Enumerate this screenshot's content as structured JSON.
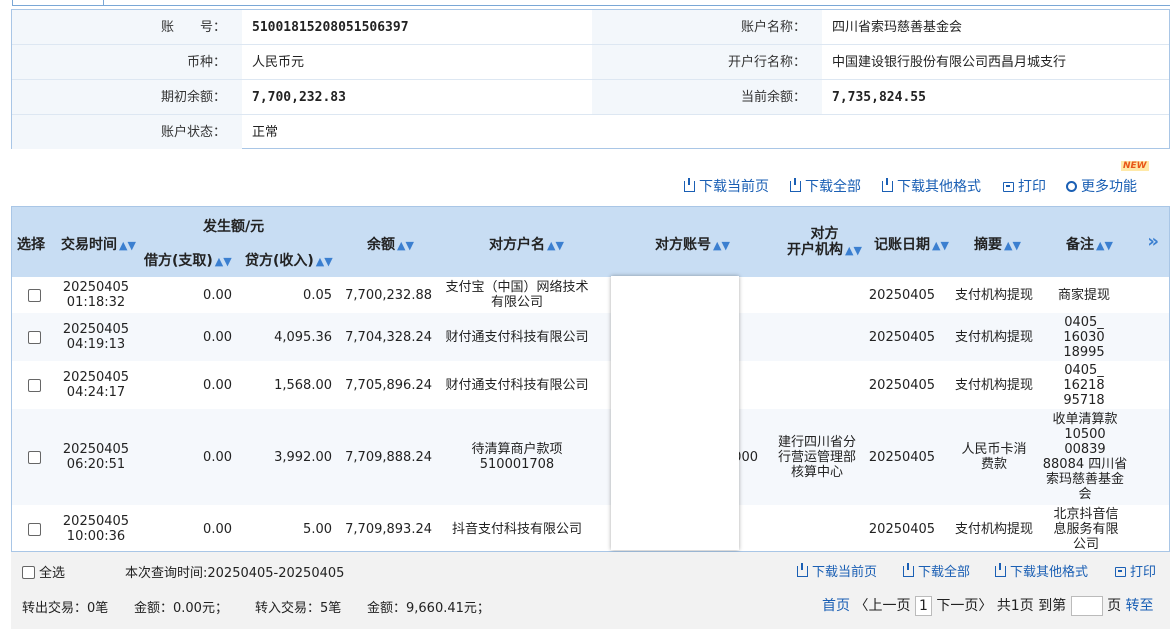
{
  "account": {
    "no_label": "账　　号：",
    "no_value": "51001815208051506397",
    "name_label": "账户名称：",
    "name_value": "四川省索玛慈善基金会",
    "currency_label": "币种：",
    "currency_value": "人民币元",
    "bank_label": "开户行名称：",
    "bank_value": "中国建设银行股份有限公司西昌月城支行",
    "opening_label": "期初余额：",
    "opening_value": "7,700,232.83",
    "current_label": "当前余额：",
    "current_value": "7,735,824.55",
    "status_label": "账户状态：",
    "status_value": "正常"
  },
  "toolbar": {
    "download_page": "下载当前页",
    "download_all": "下载全部",
    "download_other": "下载其他格式",
    "print": "打印",
    "more": "更多功能",
    "new_badge": "NEW"
  },
  "table": {
    "headers": {
      "select": "选择",
      "time": "交易时间",
      "amount_group": "发生额/元",
      "debit": "借方(支取)",
      "credit": "贷方(收入)",
      "balance": "余额",
      "counter_name": "对方户名",
      "counter_account": "对方账号",
      "counter_bank_1": "对方",
      "counter_bank_2": "开户机构",
      "post_date": "记账日期",
      "summary": "摘要",
      "remark": "备注",
      "expand": "»"
    },
    "rows": [
      {
        "date": "20250405",
        "time": "01:18:32",
        "debit": "0.00",
        "credit": "0.05",
        "balance": "7,700,232.88",
        "counter_name": "支付宝（中国）网络技术有限公司",
        "counter_account": "",
        "counter_bank": "",
        "post_date": "20250405",
        "summary": "支付机构提现",
        "remark": "商家提现"
      },
      {
        "date": "20250405",
        "time": "04:19:13",
        "debit": "0.00",
        "credit": "4,095.36",
        "balance": "7,704,328.24",
        "counter_name": "财付通支付科技有限公司",
        "counter_account": "",
        "counter_bank": "",
        "post_date": "20250405",
        "summary": "支付机构提现",
        "remark": "0405_ 16030 18995"
      },
      {
        "date": "20250405",
        "time": "04:24:17",
        "debit": "0.00",
        "credit": "1,568.00",
        "balance": "7,705,896.24",
        "counter_name": "财付通支付科技有限公司",
        "counter_account": "",
        "counter_bank": "",
        "post_date": "20250405",
        "summary": "支付机构提现",
        "remark": "0405_ 16218 95718"
      },
      {
        "date": "20250405",
        "time": "06:20:51",
        "debit": "0.00",
        "credit": "3,992.00",
        "balance": "7,709,888.24",
        "counter_name": "待清算商户款项510001708",
        "counter_account": "000",
        "counter_bank": "建行四川省分行营运管理部核算中心",
        "post_date": "20250405",
        "summary": "人民币卡消费款",
        "remark": "收单清算款 10500 00839 88084 四川省索玛慈善基金会"
      },
      {
        "date": "20250405",
        "time": "10:00:36",
        "debit": "0.00",
        "credit": "5.00",
        "balance": "7,709,893.24",
        "counter_name": "抖音支付科技有限公司",
        "counter_account": "",
        "counter_bank": "",
        "post_date": "20250405",
        "summary": "支付机构提现",
        "remark": "北京抖音信息服务有限公司"
      }
    ]
  },
  "footer": {
    "select_all": "全选",
    "query_time": "本次查询时间:20250405-20250405",
    "download_page": "下载当前页",
    "download_all": "下载全部",
    "download_other": "下载其他格式",
    "print": "打印",
    "out_tx": "转出交易：0笔",
    "out_amount": "金额：0.00元；",
    "in_tx": "转入交易：5笔",
    "in_amount": "金额：9,660.41元；",
    "first": "首页",
    "prev": "〈上一页",
    "page": "1",
    "next": "下一页〉",
    "total": "共1页",
    "goto": "到第",
    "page_unit": "页",
    "go": "转至"
  }
}
